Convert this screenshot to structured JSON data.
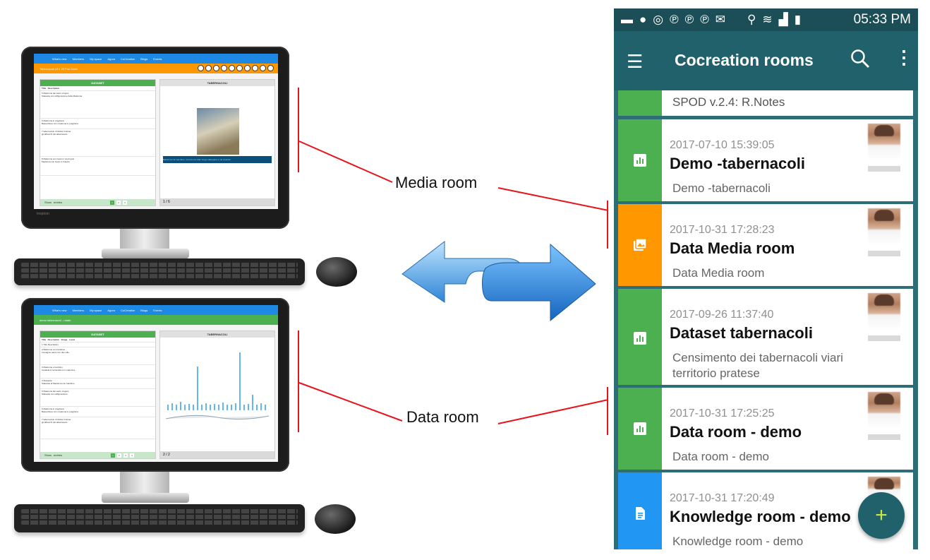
{
  "annotations": {
    "media_room": "Media room",
    "data_room": "Data room"
  },
  "desktop_top": {
    "nav": [
      "What's new",
      "Members",
      "My space",
      "Agora",
      "CoCreation",
      "Blogs",
      "Events"
    ],
    "subtitle": "Tabernacoli 18 e 20 Prai Doah",
    "left_panel_title": "DATASET",
    "left_panel_flag": "Online",
    "left_columns": [
      "Title",
      "Description"
    ],
    "rows": [
      {
        "n": "5",
        "title": "Madonna dei sacro cinguio",
        "desc": "Statuetta con raffigurazione della Madonna"
      },
      {
        "n": "6",
        "title": "Madonna in preghiera",
        "desc": "Bassorilievo con madonna in preghiera"
      },
      {
        "n": "7",
        "title": "tabernacolo di Santa Cristina",
        "desc": "gli affreschi del tabernacolo"
      },
      {
        "n": "8",
        "title": "Madonna con Gesù in via di gelo",
        "desc": "Madonna con Gesù in braccio"
      }
    ],
    "right_panel_title": "TABERNACOLI",
    "right_panel_counter": "1",
    "caption": "Madonna con bambino, incrocio tra viale borgo valsugana e via vinaccia",
    "footer_text": "1 / 6",
    "show_label": "Show",
    "entries_label": "entries",
    "pages": [
      "1",
      "2",
      "3"
    ],
    "brand": "Inspiron"
  },
  "desktop_bottom": {
    "nav": [
      "What's new",
      "Members",
      "My space",
      "Agora",
      "CoCreation",
      "Blogs",
      "Events"
    ],
    "subtitle": "demo tabernacoli - rotate",
    "left_panel_title": "DATASET",
    "left_panel_flag": "Online",
    "left_columns": [
      "Title",
      "Description",
      "Image",
      "Locat"
    ],
    "rows": [
      {
        "n": "1",
        "title": "Title",
        "desc": "Description"
      },
      {
        "n": "2",
        "title": "Madonna con bambino",
        "desc": "Immagine sacra con due ville"
      },
      {
        "n": "3",
        "title": "Madonna e bambino",
        "desc": "Candela in terracotta con madonna"
      },
      {
        "n": "4",
        "title": "Statuetta",
        "desc": "Statuetta di Madonna con bambino"
      },
      {
        "n": "5",
        "title": "Madonna del sacro cinguio",
        "desc": "Statuetta con raffigurazione"
      },
      {
        "n": "6",
        "title": "Madonna in preghiera",
        "desc": "Bassorilievo con madonna in preghiera"
      },
      {
        "n": "7",
        "title": "tabernacolo di Santa Cristina",
        "desc": "gli affreschi del tabernacolo"
      }
    ],
    "right_panel_title": "TABERNACOLI",
    "right_panel_counter": "2",
    "footer_text": "2 / 2",
    "show_label": "Show",
    "entries_label": "entries",
    "pages": [
      "1",
      "2",
      "3",
      "4"
    ]
  },
  "phone": {
    "status_time": "05:33 PM",
    "app_title": "Cocreation rooms",
    "partial_card": "SPOD v.2.4: R.Notes",
    "cards": [
      {
        "date": "2017-07-10 15:39:05",
        "title": "Demo -tabernacoli",
        "desc": "Demo -tabernacoli",
        "color": "#4caf50",
        "icon": "chart-icon"
      },
      {
        "date": "2017-10-31 17:28:23",
        "title": "Data Media room",
        "desc": "Data Media room",
        "color": "#ff9800",
        "icon": "photo-library-icon"
      },
      {
        "date": "2017-09-26 11:37:40",
        "title": "Dataset tabernacoli",
        "desc": "Censimento dei tabernacoli viari territorio pratese",
        "color": "#4caf50",
        "icon": "chart-icon"
      },
      {
        "date": "2017-10-31 17:25:25",
        "title": "Data room - demo",
        "desc": "Data room - demo",
        "color": "#4caf50",
        "icon": "chart-icon"
      },
      {
        "date": "2017-10-31 17:20:49",
        "title": "Knowledge room - demo",
        "desc": "Knowledge room - demo",
        "color": "#2196f3",
        "icon": "document-icon"
      }
    ],
    "fab_label": "+"
  }
}
